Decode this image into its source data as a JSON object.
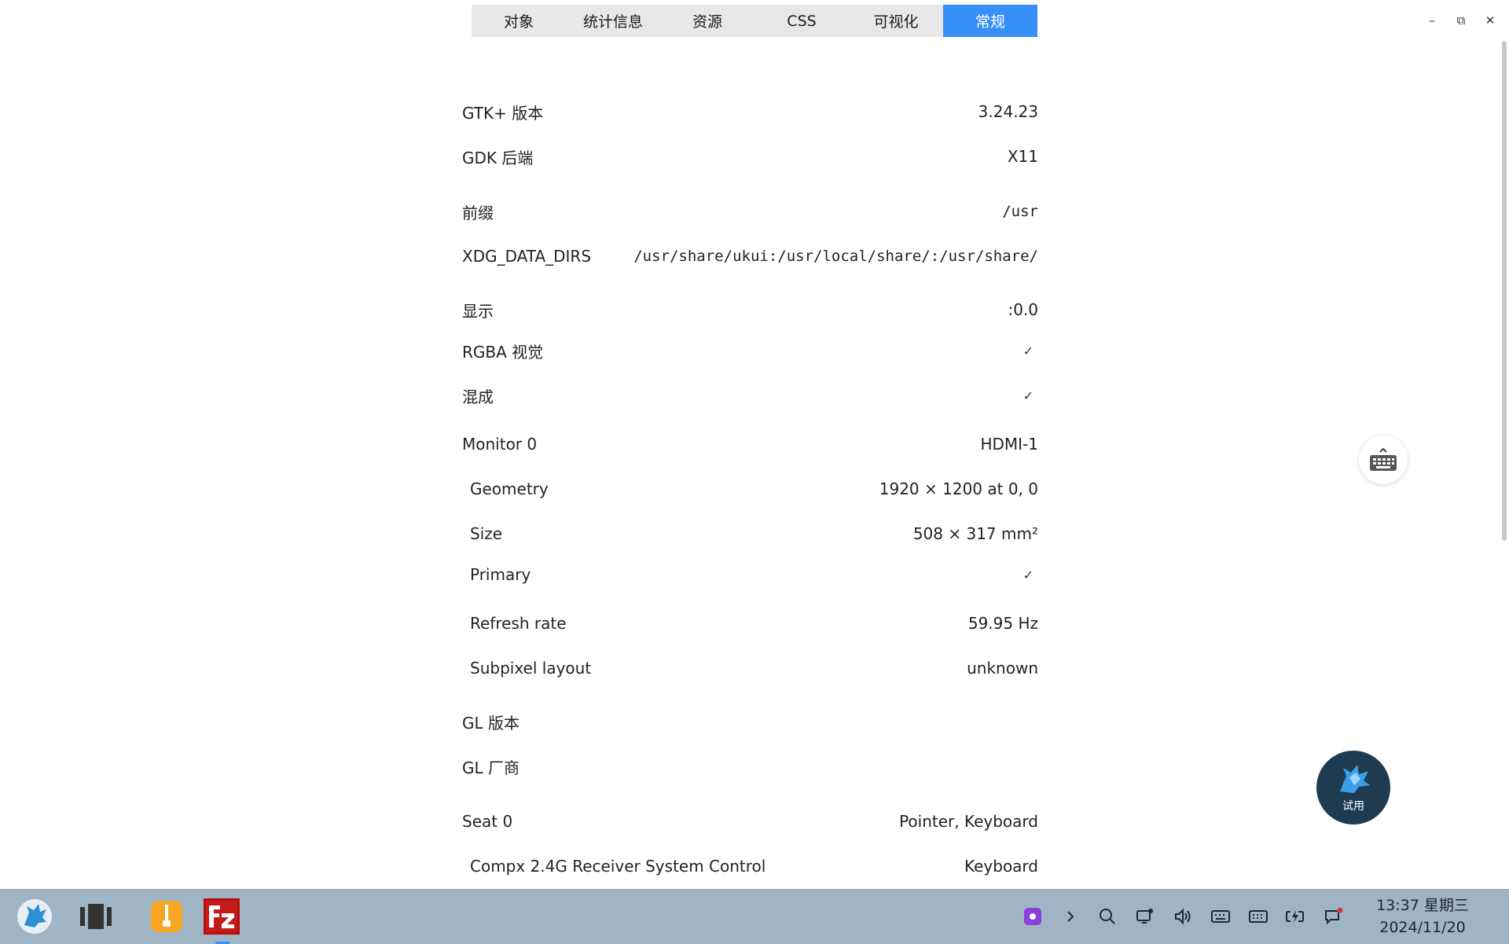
{
  "tabs": [
    {
      "label": "对象",
      "active": false
    },
    {
      "label": "统计信息",
      "active": false
    },
    {
      "label": "资源",
      "active": false
    },
    {
      "label": "CSS",
      "active": false
    },
    {
      "label": "可视化",
      "active": false
    },
    {
      "label": "常规",
      "active": true
    }
  ],
  "window_controls": {
    "minimize": "–",
    "maximize": "⧉",
    "close": "✕"
  },
  "rows": {
    "gtk_version": {
      "label": "GTK+ 版本",
      "value": "3.24.23"
    },
    "gdk_backend": {
      "label": "GDK 后端",
      "value": "X11"
    },
    "prefix": {
      "label": "前缀",
      "value": "/usr"
    },
    "xdg_data_dirs": {
      "label": "XDG_DATA_DIRS",
      "value": "/usr/share/ukui:/usr/local/share/:/usr/share/"
    },
    "display": {
      "label": "显示",
      "value": ":0.0"
    },
    "rgba_visual": {
      "label": "RGBA 视觉",
      "value": "✓"
    },
    "composited": {
      "label": "混成",
      "value": "✓"
    },
    "monitor0": {
      "label": "Monitor 0",
      "value": "HDMI-1"
    },
    "geometry": {
      "label": "Geometry",
      "value": "1920 × 1200 at 0, 0"
    },
    "size": {
      "label": "Size",
      "value": "508 × 317 mm²"
    },
    "primary": {
      "label": "Primary",
      "value": "✓"
    },
    "refresh_rate": {
      "label": "Refresh rate",
      "value": "59.95 Hz"
    },
    "subpixel_layout": {
      "label": "Subpixel layout",
      "value": "unknown"
    },
    "gl_version": {
      "label": "GL 版本",
      "value": ""
    },
    "gl_vendor": {
      "label": "GL 厂商",
      "value": ""
    },
    "seat0": {
      "label": "Seat 0",
      "value": "Pointer, Keyboard"
    },
    "compx": {
      "label": "Compx 2.4G Receiver System Control",
      "value": "Keyboard"
    }
  },
  "trial_badge": {
    "label": "试用"
  },
  "taskbar": {
    "clock_time": "13:37 星期三",
    "clock_date": "2024/11/20",
    "colors": {
      "bar": "#9fb4c4",
      "accent": "#3790fa"
    }
  }
}
